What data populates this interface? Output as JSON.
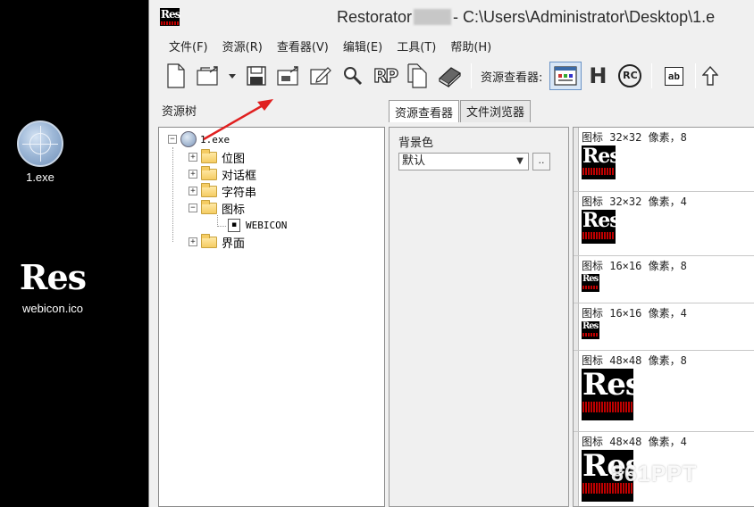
{
  "desktop": {
    "icons": [
      {
        "label": "1.exe",
        "icon": "globe-icon"
      },
      {
        "label": "webicon.ico",
        "icon": "res-icon",
        "logo_text": "Res"
      }
    ]
  },
  "window": {
    "app_icon_text": "Res",
    "title_prefix": "Restorator",
    "title_suffix": "- C:\\Users\\Administrator\\Desktop\\1.e"
  },
  "menu": [
    "文件(F)",
    "资源(R)",
    "查看器(V)",
    "编辑(E)",
    "工具(T)",
    "帮助(H)"
  ],
  "toolbar": {
    "buttons": [
      "new-file-icon",
      "open-icon",
      "dropdown-icon",
      "save-icon",
      "save-as-icon",
      "edit-icon",
      "search-icon",
      "rp-icon",
      "copy-icon",
      "book-icon"
    ],
    "rp_text": "RP",
    "viewer_label": "资源查看器:",
    "viewer_buttons": [
      "image-viewer-icon",
      "hex-viewer-icon",
      "rc-viewer-icon",
      "text-viewer-icon",
      "upload-icon"
    ],
    "hex_text": "H",
    "rc_text": "RC",
    "ab_text": "ab"
  },
  "left_pane": {
    "title": "资源树",
    "tree": {
      "root": "1.exe",
      "children": [
        "位图",
        "对话框",
        "字符串",
        "图标",
        "界面"
      ],
      "icon_child": "WEBICON"
    }
  },
  "tabs": [
    "资源查看器",
    "文件浏览器"
  ],
  "middle_pane": {
    "bg_label": "背景色",
    "bg_value": "默认",
    "ellipsis": ".."
  },
  "icons_list": [
    {
      "caption": "图标 32×32 像素，8",
      "size": 38
    },
    {
      "caption": "图标 32×32 像素，4",
      "size": 38
    },
    {
      "caption": "图标 16×16 像素，8",
      "size": 20
    },
    {
      "caption": "图标 16×16 像素，4",
      "size": 20
    },
    {
      "caption": "图标 48×48 像素，8",
      "size": 58
    },
    {
      "caption": "图标 48×48 像素，4",
      "size": 58
    }
  ],
  "watermark": "861PPT"
}
